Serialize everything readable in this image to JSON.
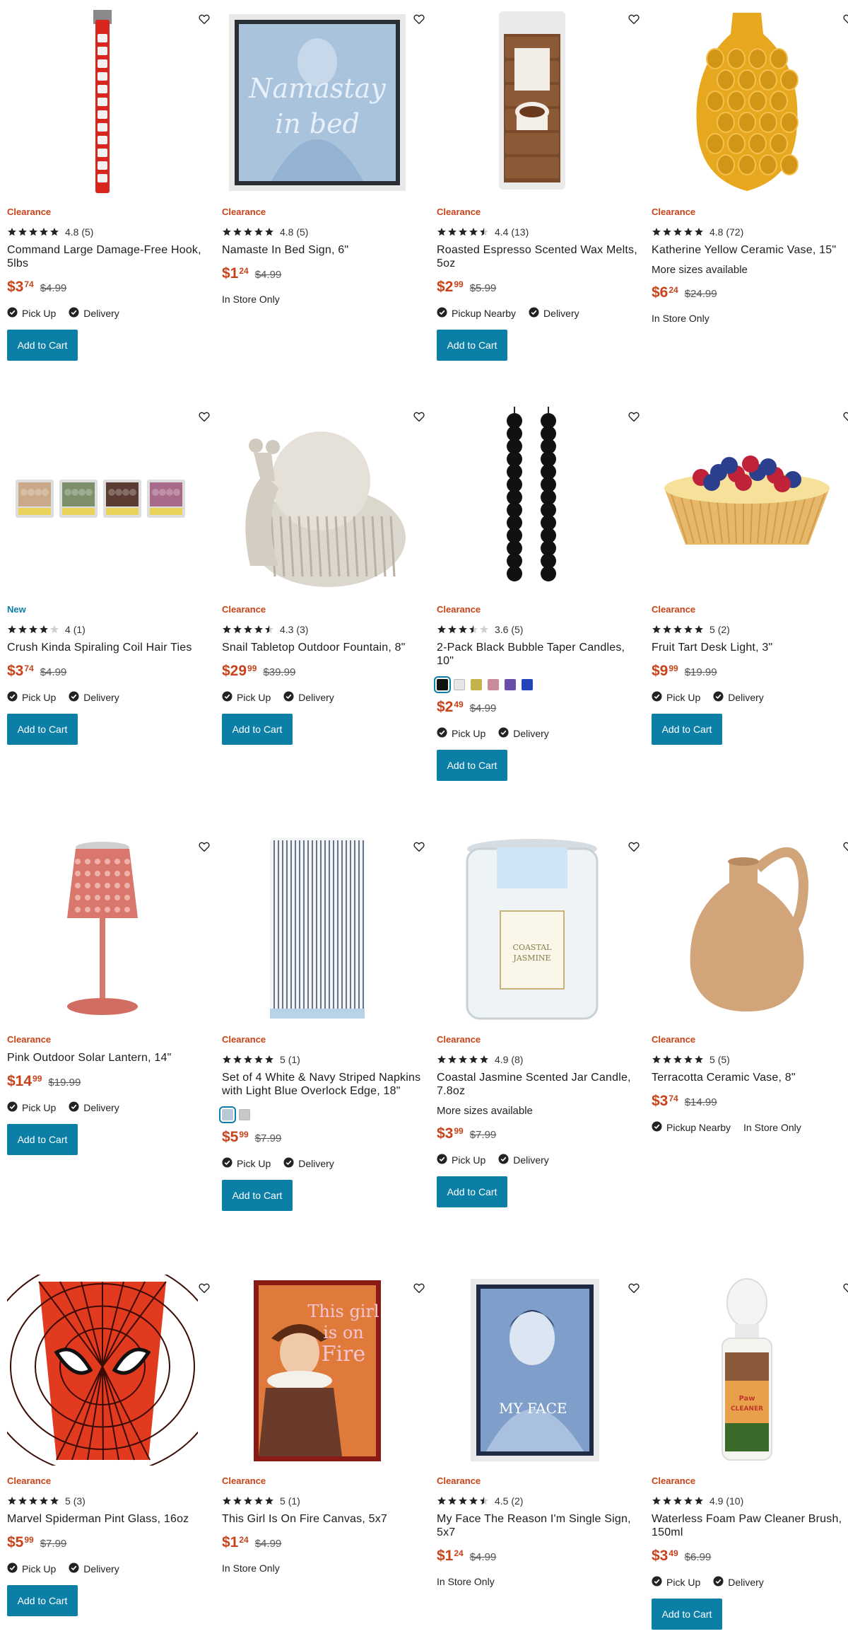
{
  "products": [
    {
      "badge": "Clearance",
      "rating_value": "4.8",
      "rating_count": "(5)",
      "stars": 5,
      "name": "Command Large Damage-Free Hook, 5lbs",
      "price_dollars": "$3",
      "price_cents": "74",
      "was_price": "$4.99",
      "fulfil1": "Pick Up",
      "fulfil2": "Delivery",
      "add_label": "Add to Cart",
      "image": "hook-strip"
    },
    {
      "badge": "Clearance",
      "rating_value": "4.8",
      "rating_count": "(5)",
      "stars": 5,
      "name": "Namaste In Bed Sign, 6\"",
      "price_dollars": "$1",
      "price_cents": "24",
      "was_price": "$4.99",
      "instore": "In Store Only",
      "image": "namaste-sign"
    },
    {
      "badge": "Clearance",
      "rating_value": "4.4",
      "rating_count": "(13)",
      "stars": 4.5,
      "name": "Roasted Espresso Scented Wax Melts, 5oz",
      "price_dollars": "$2",
      "price_cents": "99",
      "was_price": "$5.99",
      "fulfil1": "Pickup Nearby",
      "fulfil2": "Delivery",
      "add_label": "Add to Cart",
      "image": "wax-melts"
    },
    {
      "badge": "Clearance",
      "rating_value": "4.8",
      "rating_count": "(72)",
      "stars": 5,
      "name": "Katherine Yellow Ceramic Vase, 15\"",
      "more": "More sizes available",
      "price_dollars": "$6",
      "price_cents": "24",
      "was_price": "$24.99",
      "instore": "In Store Only",
      "image": "yellow-vase"
    },
    {
      "badge": "New",
      "rating_value": "4",
      "rating_count": "(1)",
      "stars": 4,
      "name": "Crush Kinda Spiraling Coil Hair Ties",
      "price_dollars": "$3",
      "price_cents": "74",
      "was_price": "$4.99",
      "fulfil1": "Pick Up",
      "fulfil2": "Delivery",
      "add_label": "Add to Cart",
      "image": "hair-ties"
    },
    {
      "badge": "Clearance",
      "rating_value": "4.3",
      "rating_count": "(3)",
      "stars": 4.5,
      "name": "Snail Tabletop Outdoor Fountain, 8\"",
      "price_dollars": "$29",
      "price_cents": "99",
      "was_price": "$39.99",
      "fulfil1": "Pick Up",
      "fulfil2": "Delivery",
      "add_label": "Add to Cart",
      "image": "snail-fountain"
    },
    {
      "badge": "Clearance",
      "rating_value": "3.6",
      "rating_count": "(5)",
      "stars": 3.5,
      "name": "2-Pack Black Bubble Taper Candles, 10\"",
      "swatches": [
        "#111111",
        "#e6e6e6",
        "#c3b44a",
        "#c98a9a",
        "#6a4fa8",
        "#2345b8"
      ],
      "price_dollars": "$2",
      "price_cents": "49",
      "was_price": "$4.99",
      "fulfil1": "Pick Up",
      "fulfil2": "Delivery",
      "add_label": "Add to Cart",
      "image": "taper-candles"
    },
    {
      "badge": "Clearance",
      "rating_value": "5",
      "rating_count": "(2)",
      "stars": 5,
      "name": "Fruit Tart Desk Light, 3\"",
      "price_dollars": "$9",
      "price_cents": "99",
      "was_price": "$19.99",
      "fulfil1": "Pick Up",
      "fulfil2": "Delivery",
      "add_label": "Add to Cart",
      "image": "fruit-tart"
    },
    {
      "badge": "Clearance",
      "name": "Pink Outdoor Solar Lantern, 14\"",
      "price_dollars": "$14",
      "price_cents": "99",
      "was_price": "$19.99",
      "fulfil1": "Pick Up",
      "fulfil2": "Delivery",
      "add_label": "Add to Cart",
      "image": "solar-lantern"
    },
    {
      "badge": "Clearance",
      "rating_value": "5",
      "rating_count": "(1)",
      "stars": 5,
      "name": "Set of 4 White & Navy Striped Napkins with Light Blue Overlock Edge, 18\"",
      "swatches": [
        "#b9c9d8",
        "#c8c8c8"
      ],
      "price_dollars": "$5",
      "price_cents": "99",
      "was_price": "$7.99",
      "fulfil1": "Pick Up",
      "fulfil2": "Delivery",
      "add_label": "Add to Cart",
      "image": "striped-napkins"
    },
    {
      "badge": "Clearance",
      "rating_value": "4.9",
      "rating_count": "(8)",
      "stars": 5,
      "name": "Coastal Jasmine Scented Jar Candle, 7.8oz",
      "more": "More sizes available",
      "price_dollars": "$3",
      "price_cents": "99",
      "was_price": "$7.99",
      "fulfil1": "Pick Up",
      "fulfil2": "Delivery",
      "add_label": "Add to Cart",
      "image": "jar-candle",
      "label_text": "COASTAL JASMINE"
    },
    {
      "badge": "Clearance",
      "rating_value": "5",
      "rating_count": "(5)",
      "stars": 5,
      "name": "Terracotta Ceramic Vase, 8\"",
      "price_dollars": "$3",
      "price_cents": "74",
      "was_price": "$14.99",
      "fulfil1": "Pickup Nearby",
      "fulfil2": "In Store Only",
      "image": "terracotta-vase"
    },
    {
      "badge": "Clearance",
      "rating_value": "5",
      "rating_count": "(3)",
      "stars": 5,
      "name": "Marvel Spiderman Pint Glass, 16oz",
      "price_dollars": "$5",
      "price_cents": "99",
      "was_price": "$7.99",
      "fulfil1": "Pick Up",
      "fulfil2": "Delivery",
      "add_label": "Add to Cart",
      "image": "spiderman-glass"
    },
    {
      "badge": "Clearance",
      "rating_value": "5",
      "rating_count": "(1)",
      "stars": 5,
      "name": "This Girl Is On Fire Canvas, 5x7",
      "price_dollars": "$1",
      "price_cents": "24",
      "was_price": "$4.99",
      "instore": "In Store Only",
      "image": "fire-canvas",
      "label_text": "This girl is on Fire"
    },
    {
      "badge": "Clearance",
      "rating_value": "4.5",
      "rating_count": "(2)",
      "stars": 4.5,
      "name": "My Face The Reason I'm Single Sign, 5x7",
      "price_dollars": "$1",
      "price_cents": "24",
      "was_price": "$4.99",
      "instore": "In Store Only",
      "image": "single-sign",
      "label_text": "MY FACE"
    },
    {
      "badge": "Clearance",
      "rating_value": "4.9",
      "rating_count": "(10)",
      "stars": 5,
      "name": "Waterless Foam Paw Cleaner Brush, 150ml",
      "price_dollars": "$3",
      "price_cents": "49",
      "was_price": "$6.99",
      "fulfil1": "Pick Up",
      "fulfil2": "Delivery",
      "add_label": "Add to Cart",
      "image": "paw-cleaner",
      "label_text": "Paw CLEANER"
    }
  ],
  "colors": {
    "accent": "#0b7fa6",
    "price": "#c8421a",
    "new_badge": "#0b7fa6"
  }
}
